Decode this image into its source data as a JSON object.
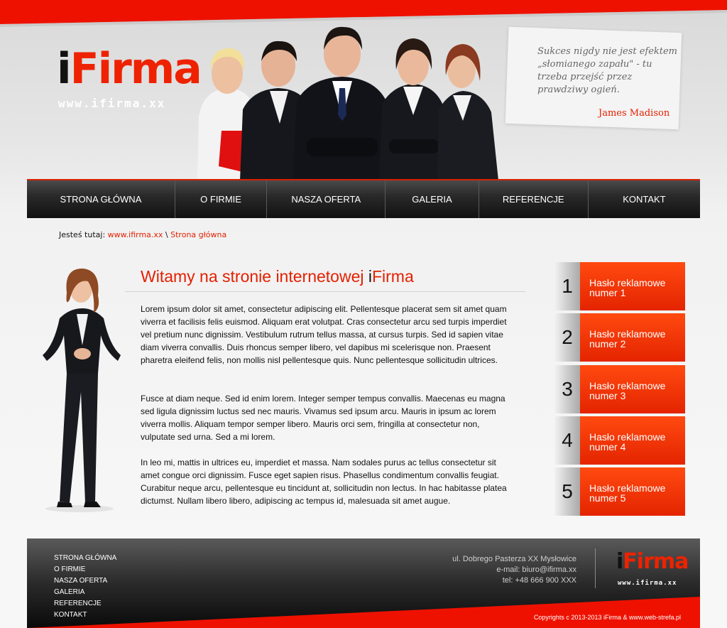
{
  "brand": {
    "logo_i": "i",
    "logo_rest": "Firma",
    "url": "www.ifirma.xx"
  },
  "quote": {
    "text": "Sukces nigdy nie jest efektem „słomianego zapału\" - tu trzeba przejść przez prawdziwy ogień.",
    "author": "James Madison"
  },
  "nav": {
    "items": [
      "STRONA GŁÓWNA",
      "O FIRMIE",
      "NASZA OFERTA",
      "GALERIA",
      "REFERENCJE",
      "KONTAKT"
    ]
  },
  "breadcrumb": {
    "label": "Jesteś tutaj:",
    "home": "www.ifirma.xx",
    "separator": "\\",
    "current": "Strona główna"
  },
  "main": {
    "title": "Witamy na stronie internetowej ",
    "title_i": "i",
    "title_rest": "Firma",
    "paragraphs": [
      "Lorem ipsum dolor sit amet, consectetur adipiscing elit. Pellentesque placerat sem sit amet quam viverra et facilisis felis euismod. Aliquam erat volutpat. Cras consectetur arcu sed turpis imperdiet vel pretium nunc dignissim. Vestibulum rutrum tellus massa, at cursus turpis. Sed id sapien vitae diam viverra convallis. Duis rhoncus semper libero, vel dapibus mi scelerisque non. Praesent pharetra eleifend felis, non mollis nisl pellentesque quis. Nunc pellentesque sollicitudin ultrices.",
      "Fusce at diam neque. Sed id enim lorem. Integer semper tempus convallis. Maecenas eu magna sed ligula dignissim luctus sed nec mauris. Vivamus sed ipsum arcu. Mauris in ipsum ac lorem viverra mollis. Aliquam tempor semper libero. Mauris orci sem, fringilla at consectetur non, vulputate sed urna. Sed a mi lorem.",
      "In leo mi, mattis in ultrices eu, imperdiet et massa. Nam sodales purus ac tellus consectetur sit amet congue orci dignissim. Fusce eget sapien risus. Phasellus condimentum convallis feugiat. Curabitur neque arcu, pellentesque eu tincidunt at, sollicitudin non lectus. In hac habitasse platea dictumst. Nullam libero libero, adipiscing ac tempus id, malesuada sit amet augue."
    ]
  },
  "slogans": [
    {
      "num": "1",
      "line1": "Hasło reklamowe",
      "line2": "numer 1"
    },
    {
      "num": "2",
      "line1": "Hasło reklamowe",
      "line2": "numer 2"
    },
    {
      "num": "3",
      "line1": "Hasło reklamowe",
      "line2": "numer 3"
    },
    {
      "num": "4",
      "line1": "Hasło reklamowe",
      "line2": "numer 4"
    },
    {
      "num": "5",
      "line1": "Hasło reklamowe",
      "line2": "numer 5"
    }
  ],
  "footer": {
    "links": [
      "STRONA GŁÓWNA",
      "O FIRMIE",
      "NASZA OFERTA",
      "GALERIA",
      "REFERENCJE",
      "KONTAKT"
    ],
    "address": "ul. Dobrego Pasterza XX Mysłowice",
    "email": "e-mail: biuro@ifirma.xx",
    "phone": "tel: +48 666 900 XXX",
    "copyright": "Copyrights c 2013-2013 iFirma & www.web-strefa.pl"
  },
  "colors": {
    "accent": "#e42000",
    "nav_bg": "#1a1a1a",
    "slogan_bg": "#ff4010"
  }
}
